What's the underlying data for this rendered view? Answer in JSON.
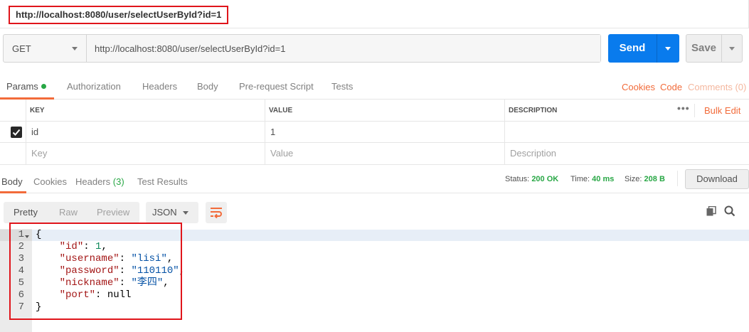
{
  "title_tab": {
    "label": "http://localhost:8080/user/selectUserById?id=1"
  },
  "request": {
    "method": "GET",
    "url": "http://localhost:8080/user/selectUserById?id=1",
    "send_label": "Send",
    "save_label": "Save"
  },
  "request_tabs": {
    "items": [
      "Params",
      "Authorization",
      "Headers",
      "Body",
      "Pre-request Script",
      "Tests"
    ],
    "links": {
      "cookies": "Cookies",
      "code": "Code",
      "comments": "Comments (0)"
    }
  },
  "params": {
    "headers": {
      "key": "KEY",
      "value": "VALUE",
      "description": "DESCRIPTION"
    },
    "rows": [
      {
        "checked": true,
        "key": "id",
        "value": "1",
        "description": ""
      }
    ],
    "placeholders": {
      "key": "Key",
      "value": "Value",
      "description": "Description"
    },
    "more_label": "•••",
    "bulk_edit": "Bulk Edit"
  },
  "response_tabs": {
    "body": "Body",
    "cookies": "Cookies",
    "headers": "Headers",
    "headers_count": "(3)",
    "test_results": "Test Results"
  },
  "response_meta": {
    "status_label": "Status:",
    "status_value": "200 OK",
    "time_label": "Time:",
    "time_value": "40 ms",
    "size_label": "Size:",
    "size_value": "208 B",
    "download": "Download"
  },
  "response_toolbar": {
    "views": [
      "Pretty",
      "Raw",
      "Preview"
    ],
    "format": "JSON"
  },
  "editor": {
    "line_numbers": [
      "1",
      "2",
      "3",
      "4",
      "5",
      "6",
      "7"
    ],
    "json": {
      "open": "{",
      "id_key": "\"id\"",
      "id_val": "1",
      "username_key": "\"username\"",
      "username_val": "\"lisi\"",
      "password_key": "\"password\"",
      "password_val": "\"110110\"",
      "nickname_key": "\"nickname\"",
      "nickname_val": "\"李四\"",
      "port_key": "\"port\"",
      "port_val": "null",
      "close": "}"
    }
  },
  "colors": {
    "accent": "#f26b3a",
    "send": "#097bed",
    "success": "#28a745",
    "highlight": "#e0151b"
  }
}
